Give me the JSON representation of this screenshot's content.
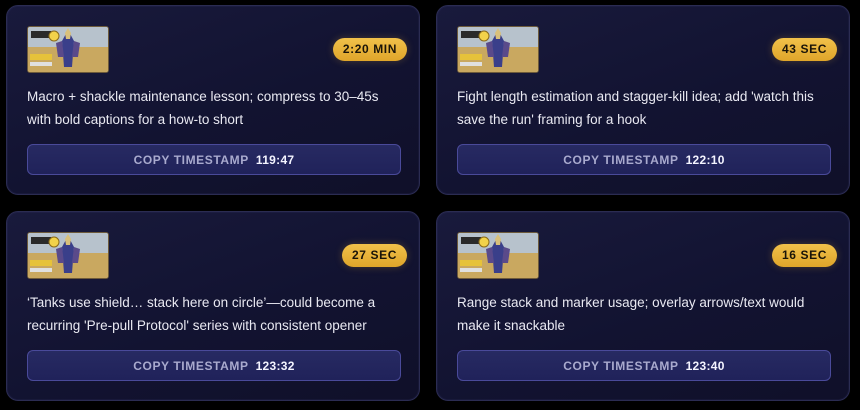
{
  "clips": [
    {
      "duration": "2:20 MIN",
      "description": "Macro + shackle maintenance lesson; compress to 30–45s with bold captions for a how-to short",
      "copy_label": "COPY TIMESTAMP",
      "timestamp": "119:47"
    },
    {
      "duration": "43 SEC",
      "description": "Fight length estimation and stagger-kill idea; add 'watch this save the run' framing for a hook",
      "copy_label": "COPY TIMESTAMP",
      "timestamp": "122:10"
    },
    {
      "duration": "27 SEC",
      "description": "‘Tanks use shield… stack here on circle’—could become a recurring 'Pre-pull Protocol' series with consistent opener",
      "copy_label": "COPY TIMESTAMP",
      "timestamp": "123:32"
    },
    {
      "duration": "16 SEC",
      "description": "Range stack and marker usage; overlay arrows/text would make it snackable",
      "copy_label": "COPY TIMESTAMP",
      "timestamp": "123:40"
    }
  ],
  "thumbnail": {
    "logo_text": "WARCRAFT",
    "title_text": "ONE GUARD"
  },
  "colors": {
    "badge": "#e8b53a",
    "card_bg": "#15163a",
    "button_bg": "#23255e",
    "button_border": "#4a4a9a"
  }
}
